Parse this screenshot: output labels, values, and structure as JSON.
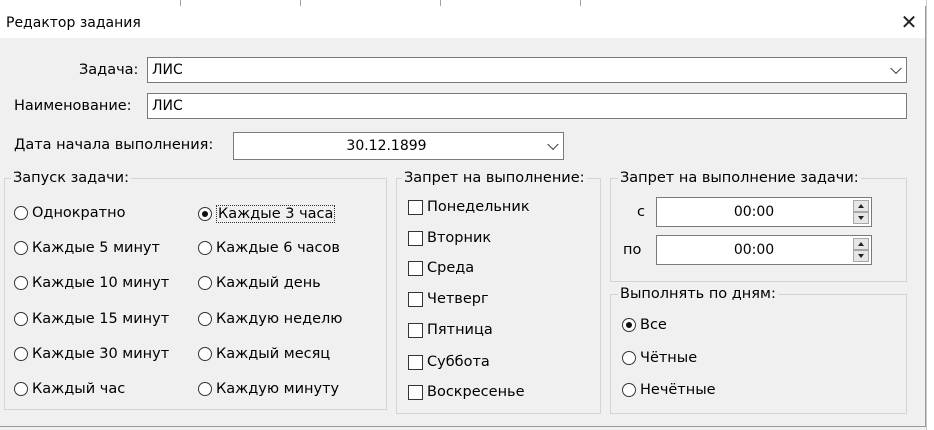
{
  "window": {
    "title": "Редактор задания"
  },
  "task": {
    "label": "Задача:",
    "value": "ЛИС"
  },
  "name": {
    "label": "Наименование:",
    "value": "ЛИС"
  },
  "start_date": {
    "label": "Дата начала выполнения:",
    "value": "30.12.1899"
  },
  "launch": {
    "title": "Запуск задачи:",
    "options": [
      {
        "label": "Однократно",
        "selected": false
      },
      {
        "label": "Каждые 5 минут",
        "selected": false
      },
      {
        "label": "Каждые 10 минут",
        "selected": false
      },
      {
        "label": "Каждые 15 минут",
        "selected": false
      },
      {
        "label": "Каждые 30 минут",
        "selected": false
      },
      {
        "label": "Каждый час",
        "selected": false
      },
      {
        "label": "Каждые 3 часа",
        "selected": true
      },
      {
        "label": "Каждые 6 часов",
        "selected": false
      },
      {
        "label": "Каждый день",
        "selected": false
      },
      {
        "label": "Каждую неделю",
        "selected": false
      },
      {
        "label": "Каждый месяц",
        "selected": false
      },
      {
        "label": "Каждую минуту",
        "selected": false
      }
    ]
  },
  "forbid_days": {
    "title": "Запрет на выполнение:",
    "days": [
      {
        "label": "Понедельник",
        "checked": false
      },
      {
        "label": "Вторник",
        "checked": false
      },
      {
        "label": "Среда",
        "checked": false
      },
      {
        "label": "Четверг",
        "checked": false
      },
      {
        "label": "Пятница",
        "checked": false
      },
      {
        "label": "Суббота",
        "checked": false
      },
      {
        "label": "Воскресенье",
        "checked": false
      }
    ]
  },
  "forbid_time": {
    "title": "Запрет на выполнение задачи:",
    "from_label": "с",
    "from_value": "00:00",
    "to_label": "по",
    "to_value": "00:00"
  },
  "run_days": {
    "title": "Выполнять по дням:",
    "options": [
      {
        "label": "Все",
        "selected": true
      },
      {
        "label": "Чётные",
        "selected": false
      },
      {
        "label": "Нечётные",
        "selected": false
      }
    ]
  }
}
